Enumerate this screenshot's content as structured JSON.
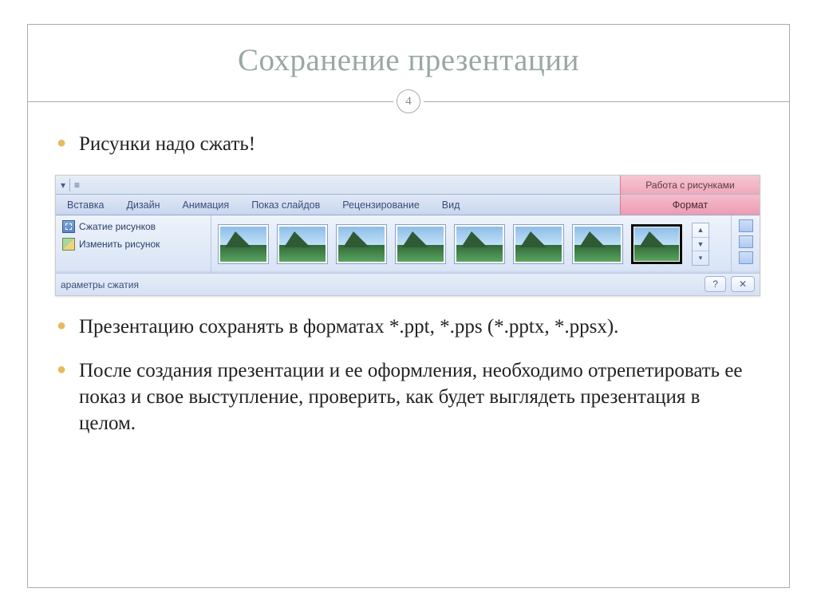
{
  "slide": {
    "title": "Сохранение презентации",
    "number": "4",
    "bullets": [
      "Рисунки надо сжать!",
      "Презентацию сохранять в форматах *.ppt, *.pps (*.pptx, *.ppsx).",
      "После создания презентации и ее оформления, необходимо отрепетировать ее показ и свое выступление, проверить, как будет выглядеть презентация в целом."
    ]
  },
  "ribbon": {
    "contextual_title": "Работа с рисунками",
    "tabs": {
      "insert": "Вставка",
      "design": "Дизайн",
      "animation": "Анимация",
      "slideshow": "Показ слайдов",
      "review": "Рецензирование",
      "view": "Вид",
      "format": "Формат"
    },
    "commands": {
      "compress": "Сжатие рисунков",
      "change": "Изменить рисунок"
    },
    "footer_label": "араметры сжатия",
    "help_symbol": "?",
    "close_symbol": "✕"
  }
}
